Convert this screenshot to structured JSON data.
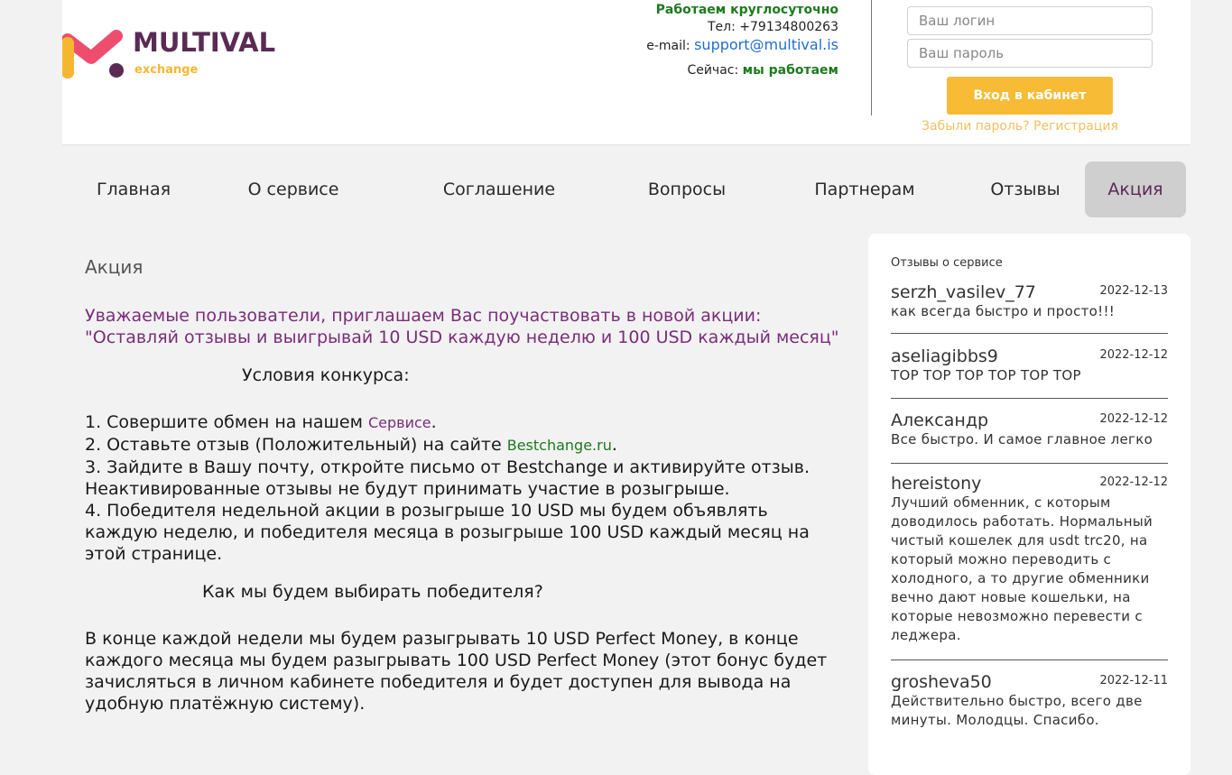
{
  "header": {
    "logo": {
      "name": "MULTIVAL",
      "sub": "exchange"
    },
    "contacts": {
      "hours": "Работаем круглосуточно",
      "phone_label": "Тел:",
      "phone": "+79134800263",
      "email_label": "e-mail:",
      "email": "support@multival.is",
      "now_label": "Сейчас:",
      "now_status": "мы работаем"
    },
    "login": {
      "login_placeholder": "Ваш логин",
      "password_placeholder": "Ваш пароль",
      "button_label": "Вход в кабинет",
      "forgot_label": "Забыли пароль?",
      "register_label": "Регистрация"
    }
  },
  "nav": {
    "items": [
      {
        "label": "Главная"
      },
      {
        "label": "О сервисе"
      },
      {
        "label": "Соглашение"
      },
      {
        "label": "Вопросы"
      },
      {
        "label": "Партнерам"
      },
      {
        "label": "Отзывы"
      },
      {
        "label": "Акция"
      }
    ]
  },
  "main": {
    "title": "Акция",
    "intro_line1": "Уважаемые пользователи, приглашаем Вас поучаствовать в новой акции:",
    "intro_line2": "\"Оставляй отзывы и выигрывай 10 USD каждую неделю и 100 USD каждый месяц\"",
    "conditions_heading": "Условия конкурса:",
    "step1_text": "1. Совершите обмен на нашем ",
    "step1_link": "Сервисе",
    "step2_text": "2. Оставьте отзыв (Положительный) на сайте ",
    "step2_link": "Bestchange.ru",
    "step3": "3. Зайдите в Вашу почту, откройте письмо от Bestchange и активируйте отзыв. Неактивированные отзывы не будут принимать участие в розыгрыше.",
    "step4": "4. Победителя недельной акции в розыгрыше 10 USD мы будем объявлять каждую неделю, и победителя месяца в розыгрыше 100 USD каждый месяц на этой странице.",
    "choose_heading": "Как мы будем выбирать победителя?",
    "final": "В конце каждой недели мы будем разыгрывать 10 USD Perfect Money, в конце каждого месяца мы будем разыгрывать 100 USD Perfect Money (этот бонус будет зачисляться в личном кабинете победителя и будет доступен для вывода на удобную платёжную систему)."
  },
  "reviews": {
    "title": "Отзывы о сервисе",
    "items": [
      {
        "name": "serzh_vasilev_77",
        "date": "2022-12-13",
        "text": "как всегда быстро и просто!!!"
      },
      {
        "name": "aseliagibbs9",
        "date": "2022-12-12",
        "text": "TOP TOP TOP TOP TOP TOP"
      },
      {
        "name": "Александр",
        "date": "2022-12-12",
        "text": "Все быстро. И самое главное легко"
      },
      {
        "name": "hereistony",
        "date": "2022-12-12",
        "text": "Лучший обменник, с которым доводилось работать. Нормальный чистый кошелек для usdt trc20, на который можно переводить с холодного, а то другие обменники вечно дают новые кошельки, на которые невозможно перевести с леджера."
      },
      {
        "name": "grosheva50",
        "date": "2022-12-11",
        "text": "Действительно быстро, всего две минуты. Молодцы. Спасибо."
      }
    ]
  }
}
